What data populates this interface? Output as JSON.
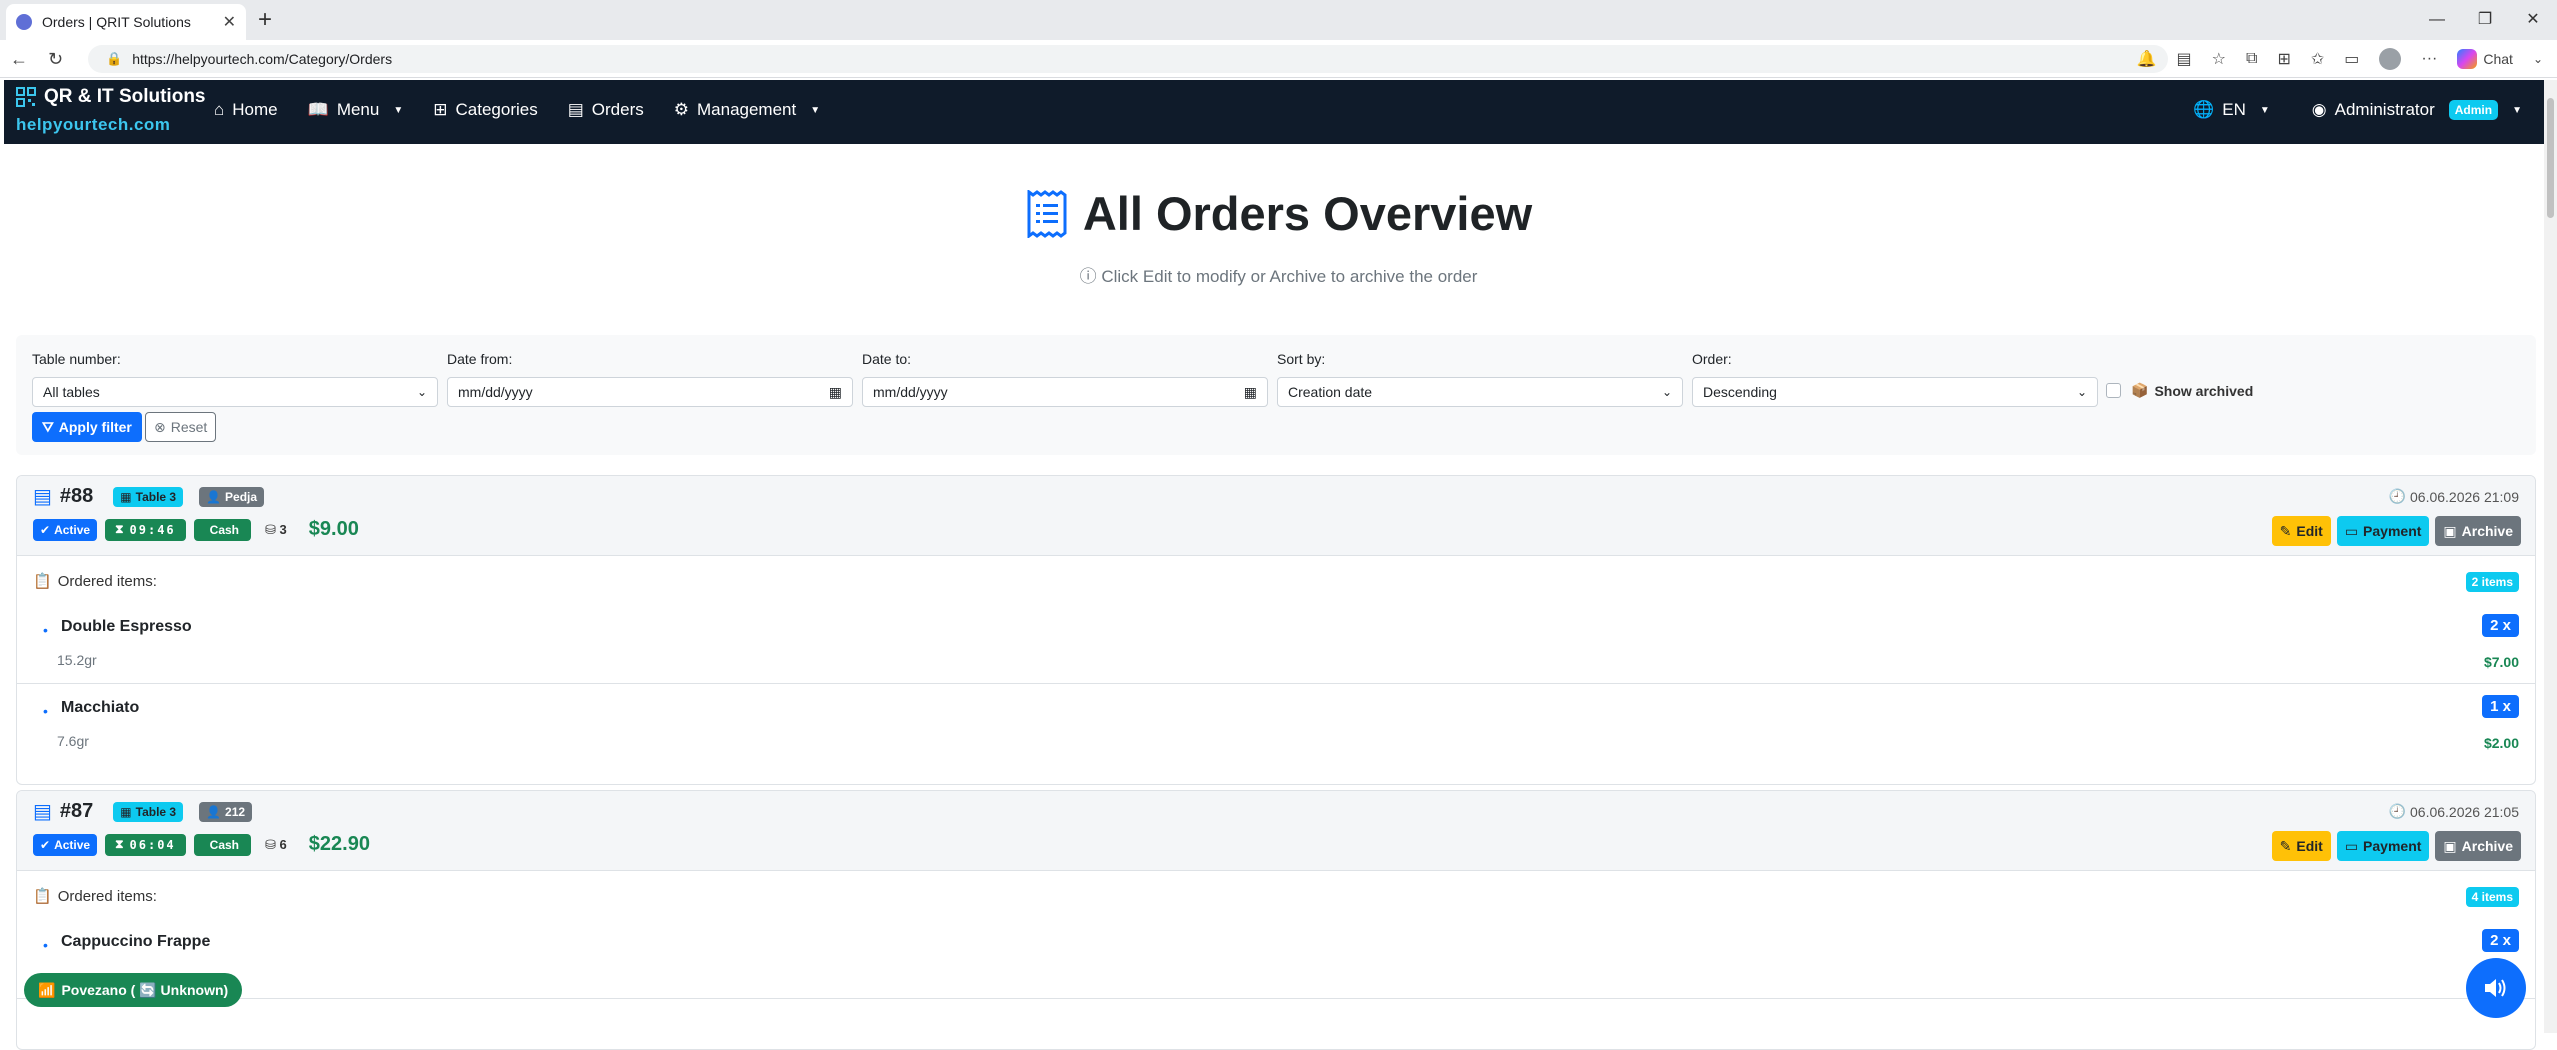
{
  "browser": {
    "tab_title": "Orders | QRIT Solutions",
    "url": "https://helpyourtech.com/Category/Orders",
    "chat_label": "Chat"
  },
  "navbar": {
    "brand_title": "QR & IT Solutions",
    "brand_domain": "helpyourtech.com",
    "links": {
      "home": "Home",
      "menu": "Menu",
      "categories": "Categories",
      "orders": "Orders",
      "management": "Management"
    },
    "language": "EN",
    "user": "Administrator",
    "user_badge": "Admin"
  },
  "page": {
    "title": "All Orders Overview",
    "subtitle": "Click Edit to modify or Archive to archive the order"
  },
  "filters": {
    "table_label": "Table number:",
    "table_value": "All tables",
    "date_from_label": "Date from:",
    "date_from_placeholder": "mm/dd/yyyy",
    "date_to_label": "Date to:",
    "date_to_placeholder": "mm/dd/yyyy",
    "sort_label": "Sort by:",
    "sort_value": "Creation date",
    "order_label": "Order:",
    "order_value": "Descending",
    "show_archived": "Show archived",
    "apply": "Apply filter",
    "reset": "Reset"
  },
  "common": {
    "ordered_items": "Ordered items:",
    "edit": "Edit",
    "payment": "Payment",
    "archive": "Archive"
  },
  "orders": [
    {
      "id": "#88",
      "table": "Table 3",
      "user": "Pedja",
      "status": "Active",
      "timer": "09:46",
      "payment": "Cash",
      "pieces": "3",
      "total": "$9.00",
      "time": "06.06.2026 21:09",
      "items_count": "2 items",
      "items": [
        {
          "name": "Double Espresso",
          "weight": "15.2gr",
          "qty": "2 x",
          "price": "$7.00"
        },
        {
          "name": "Macchiato",
          "weight": "7.6gr",
          "qty": "1 x",
          "price": "$2.00"
        }
      ]
    },
    {
      "id": "#87",
      "table": "Table 3",
      "user": "212",
      "status": "Active",
      "timer": "06:04",
      "payment": "Cash",
      "pieces": "6",
      "total": "$22.90",
      "time": "06.06.2026 21:05",
      "items_count": "4 items",
      "items": [
        {
          "name": "Cappuccino Frappe",
          "qty": "2 x"
        }
      ]
    }
  ],
  "status_bar": {
    "wifi": "Povezano ( 🔄 Unknown)"
  }
}
